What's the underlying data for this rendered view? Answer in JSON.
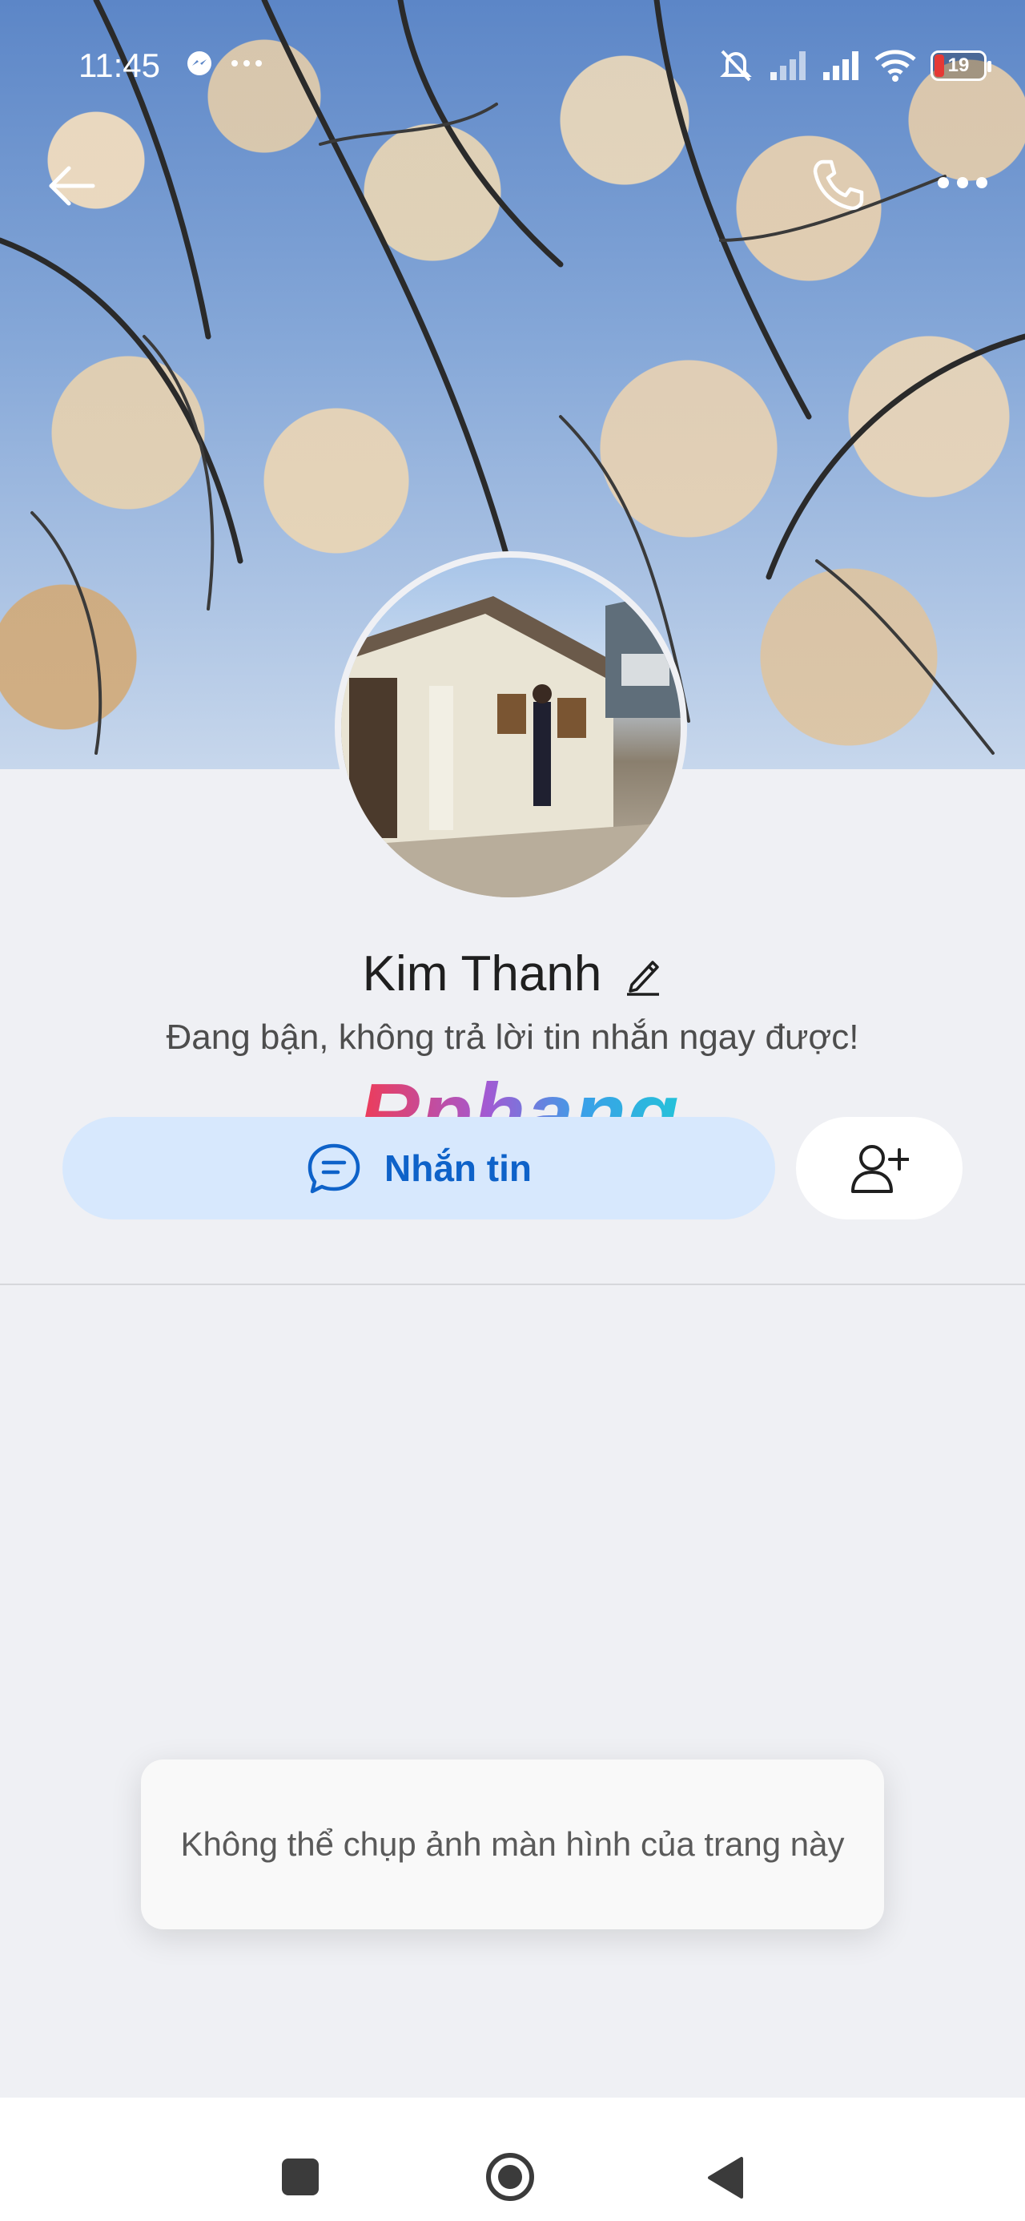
{
  "status_bar": {
    "time": "11:45",
    "battery": "19",
    "icons": [
      "messenger-icon",
      "more-dots-icon",
      "mute-icon",
      "signal-icon",
      "signal-icon",
      "wifi-icon",
      "battery-icon"
    ]
  },
  "header": {
    "back_icon": "arrow-left-icon",
    "call_icon": "phone-icon",
    "more_icon": "more-horizontal-icon"
  },
  "profile": {
    "name": "Kim Thanh",
    "status_message": "Đang bận, không trả lời tin nhắn ngay được!",
    "watermark": "Rphang"
  },
  "actions": {
    "message_label": "Nhắn tin",
    "message_icon": "chat-bubble-icon",
    "add_friend_icon": "add-friend-icon"
  },
  "toast": {
    "text": "Không thể chụp ảnh màn hình của trang này"
  },
  "colors": {
    "accent": "#0e62c9",
    "message_button_bg": "#d7e8fd",
    "page_bg": "#eff0f4"
  }
}
